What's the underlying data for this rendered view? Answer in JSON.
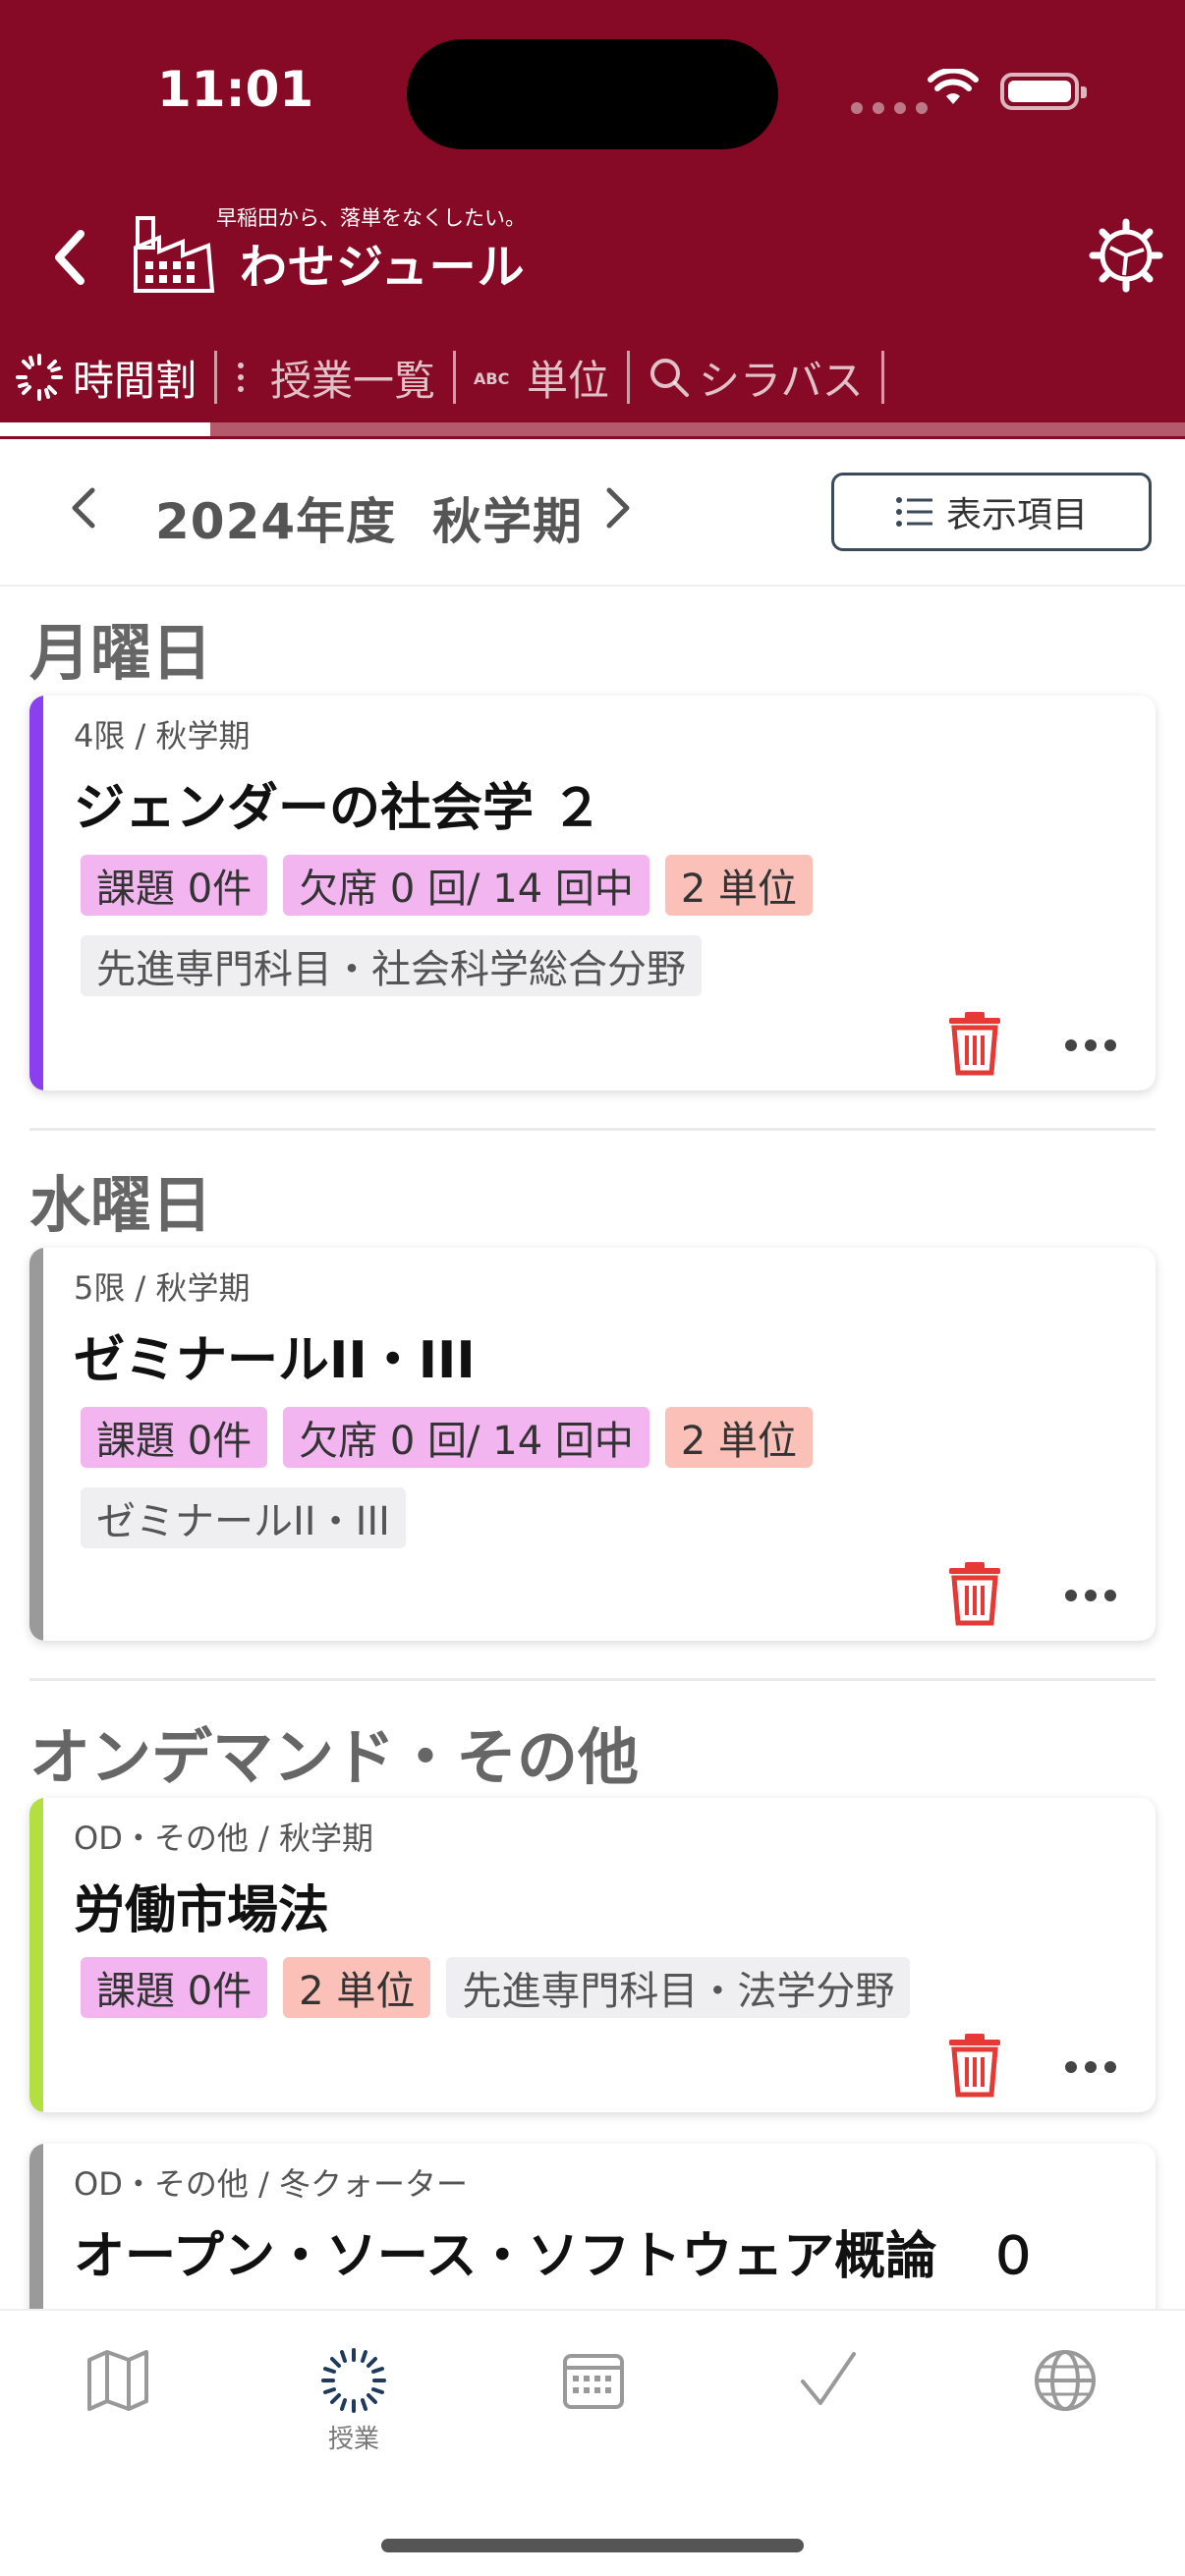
{
  "status_bar": {
    "time": "11:01"
  },
  "header": {
    "tagline": "早稲田から、落単をなくしたい。",
    "app_title": "わせジュール",
    "back_icon": "chevron-left-icon",
    "settings_icon": "gear-icon"
  },
  "nav": {
    "tabs": [
      {
        "label": "時間割",
        "icon": "spinner-icon",
        "active": true
      },
      {
        "label": "授業一覧",
        "icon": "list-icon",
        "active": false
      },
      {
        "label": "単位",
        "icon": "abc-icon",
        "active": false
      },
      {
        "label": "シラバス",
        "icon": "search-icon",
        "active": false
      }
    ]
  },
  "term": {
    "label": "2024年度  秋学期",
    "display_items_label": "表示項目"
  },
  "sections": [
    {
      "heading": "月曜日",
      "cards": [
        {
          "meta": "4限 / 秋学期",
          "title": "ジェンダーの社会学 ２",
          "accent": "#8a3ff0",
          "badges_row1": [
            {
              "type": "task",
              "text": "課題 0件"
            },
            {
              "type": "absence",
              "text": "欠席 0 回/ 14 回中"
            },
            {
              "type": "credits",
              "text": "2 単位"
            }
          ],
          "badges_row2": [
            {
              "type": "category",
              "text": "先進専門科目・社会科学総合分野"
            }
          ]
        }
      ]
    },
    {
      "heading": "水曜日",
      "cards": [
        {
          "meta": "5限 / 秋学期",
          "title": "ゼミナールII・III",
          "accent": "#999999",
          "badges_row1": [
            {
              "type": "task",
              "text": "課題 0件"
            },
            {
              "type": "absence",
              "text": "欠席 0 回/ 14 回中"
            },
            {
              "type": "credits",
              "text": "2 単位"
            }
          ],
          "badges_row2": [
            {
              "type": "category",
              "text": "ゼミナールII・III"
            }
          ]
        }
      ]
    },
    {
      "heading": "オンデマンド・その他",
      "cards": [
        {
          "meta": "OD・その他 / 秋学期",
          "title": "労働市場法",
          "accent": "#b3e040",
          "badges_row1": [
            {
              "type": "task",
              "text": "課題 0件"
            },
            {
              "type": "credits",
              "text": "2 単位"
            },
            {
              "type": "category",
              "text": "先進専門科目・法学分野"
            }
          ]
        },
        {
          "meta": "OD・その他 / 冬クォーター",
          "title": "オープン・ソース・ソフトウェア概論　０",
          "accent": "#999999"
        }
      ]
    }
  ],
  "bottom_nav": {
    "items": [
      {
        "icon": "map-icon",
        "label": ""
      },
      {
        "icon": "spinner-icon",
        "label": "授業"
      },
      {
        "icon": "calendar-icon",
        "label": ""
      },
      {
        "icon": "checkmark-icon",
        "label": ""
      },
      {
        "icon": "globe-icon",
        "label": ""
      }
    ]
  },
  "colors": {
    "header_bg": "#860a25",
    "delete_red": "#e53935",
    "task_badge": "#f3b5ef",
    "credits_badge": "#fbc0b8",
    "category_badge": "#efeff1"
  }
}
